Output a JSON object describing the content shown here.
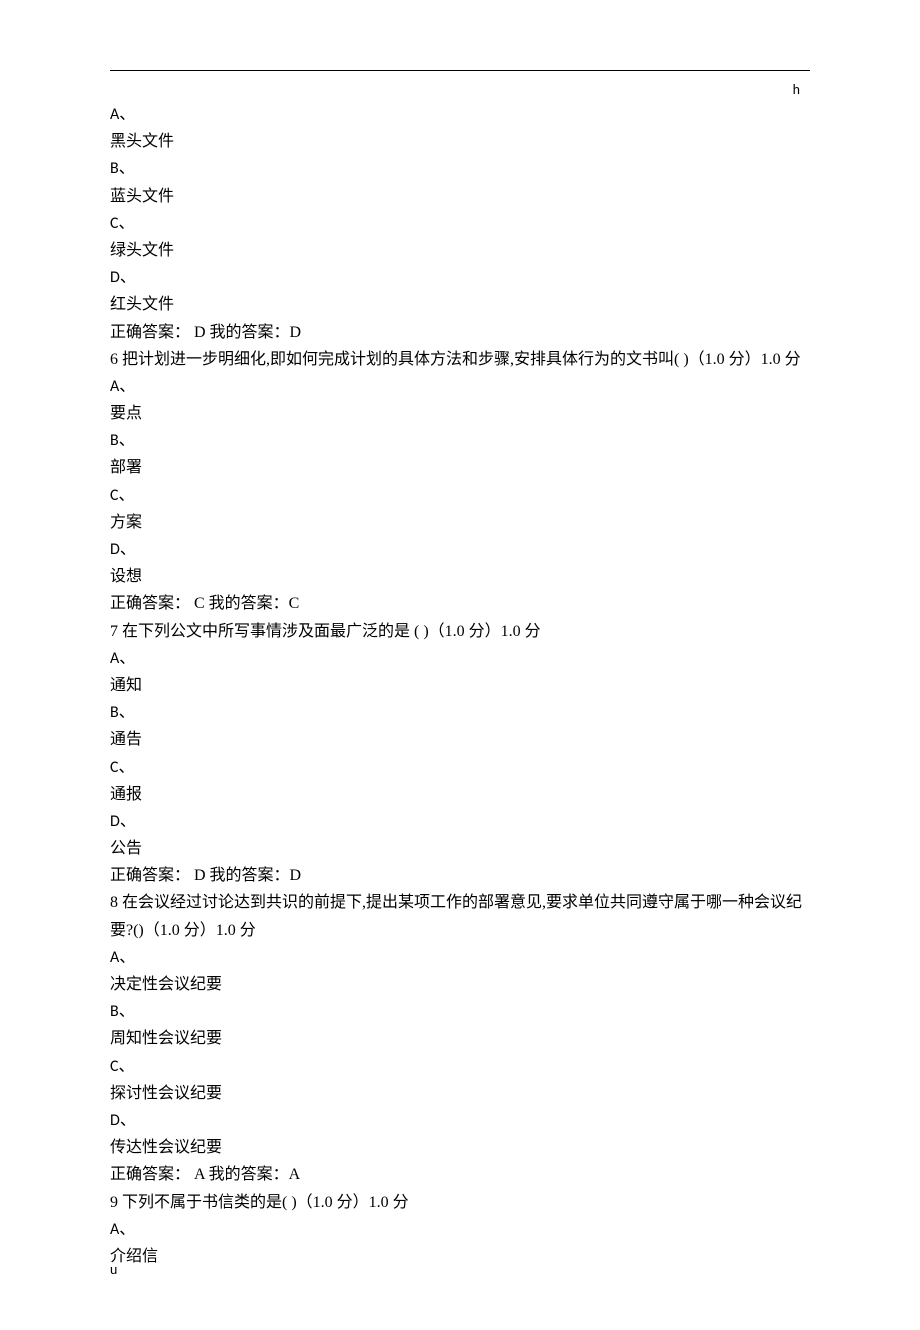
{
  "header_mark": "h",
  "footer_mark": "u",
  "q5": {
    "optA_label": "A、",
    "optA_text": "黑头文件",
    "optB_label": "B、",
    "optB_text": "蓝头文件",
    "optC_label": "C、",
    "optC_text": "绿头文件",
    "optD_label": "D、",
    "optD_text": "红头文件",
    "answer": "正确答案： D 我的答案：D"
  },
  "q6": {
    "stem": "6 把计划进一步明细化,即如何完成计划的具体方法和步骤,安排具体行为的文书叫( )（1.0 分）1.0 分",
    "optA_label": "A、",
    "optA_text": "要点",
    "optB_label": "B、",
    "optB_text": "部署",
    "optC_label": "C、",
    "optC_text": "方案",
    "optD_label": "D、",
    "optD_text": "设想",
    "answer": "正确答案： C 我的答案：C"
  },
  "q7": {
    "stem": "7 在下列公文中所写事情涉及面最广泛的是 ( )（1.0 分）1.0 分",
    "optA_label": "A、",
    "optA_text": "通知",
    "optB_label": "B、",
    "optB_text": "通告",
    "optC_label": "C、",
    "optC_text": "通报",
    "optD_label": "D、",
    "optD_text": "公告",
    "answer": "正确答案： D 我的答案：D"
  },
  "q8": {
    "stem": "8 在会议经过讨论达到共识的前提下,提出某项工作的部署意见,要求单位共同遵守属于哪一种会议纪要?()（1.0 分）1.0 分",
    "optA_label": "A、",
    "optA_text": "决定性会议纪要",
    "optB_label": "B、",
    "optB_text": "周知性会议纪要",
    "optC_label": "C、",
    "optC_text": "探讨性会议纪要",
    "optD_label": "D、",
    "optD_text": "传达性会议纪要",
    "answer": "正确答案： A 我的答案：A"
  },
  "q9": {
    "stem": "9 下列不属于书信类的是( )（1.0 分）1.0 分",
    "optA_label": "A、",
    "optA_text": "介绍信"
  }
}
